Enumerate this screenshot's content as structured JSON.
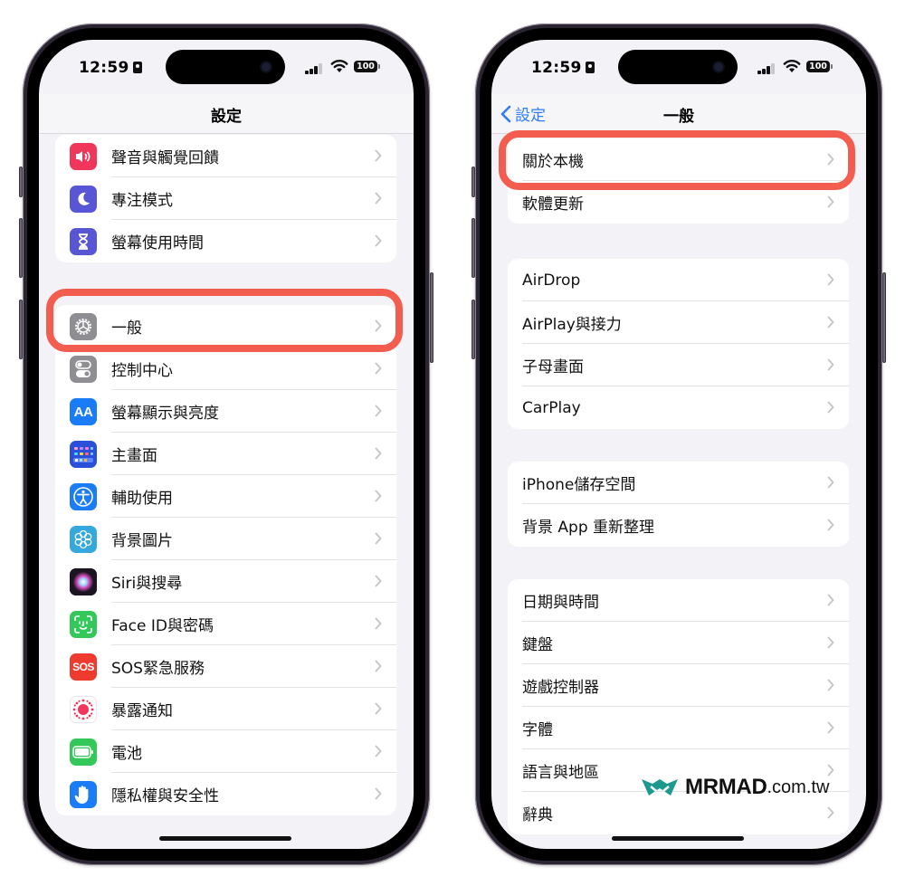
{
  "status_bar": {
    "time": "12:59",
    "battery": "100"
  },
  "left_screen": {
    "title": "設定",
    "groups": [
      {
        "items": [
          {
            "label": "聲音與觸覺回饋",
            "icon": "speaker-icon",
            "color": "#f0365a"
          },
          {
            "label": "專注模式",
            "icon": "moon-icon",
            "color": "#5956d6"
          },
          {
            "label": "螢幕使用時間",
            "icon": "hourglass-icon",
            "color": "#5956d6"
          }
        ]
      },
      {
        "items": [
          {
            "label": "一般",
            "icon": "gear-icon",
            "color": "#8e8e93",
            "highlighted": true
          },
          {
            "label": "控制中心",
            "icon": "toggle-icon",
            "color": "#8e8e93"
          },
          {
            "label": "螢幕顯示與亮度",
            "icon": "text-size-icon",
            "color": "#1a7cf6",
            "glyph": "AA"
          },
          {
            "label": "主畫面",
            "icon": "home-grid-icon",
            "color": "#2a4fd8"
          },
          {
            "label": "輔助使用",
            "icon": "accessibility-icon",
            "color": "#1a7cf6"
          },
          {
            "label": "背景圖片",
            "icon": "flower-icon",
            "color": "#35a9dc"
          },
          {
            "label": "Siri與搜尋",
            "icon": "siri-icon",
            "color": "#2a1a2e"
          },
          {
            "label": "Face ID與密碼",
            "icon": "face-id-icon",
            "color": "#34c759"
          },
          {
            "label": "SOS緊急服務",
            "icon": "sos-icon",
            "color": "#ee3b30",
            "glyph": "SOS"
          },
          {
            "label": "暴露通知",
            "icon": "exposure-icon",
            "color": "#ffffff"
          },
          {
            "label": "電池",
            "icon": "battery-icon",
            "color": "#34c759"
          },
          {
            "label": "隱私權與安全性",
            "icon": "hand-icon",
            "color": "#1a7cf6"
          }
        ]
      }
    ]
  },
  "right_screen": {
    "title": "一般",
    "back_label": "設定",
    "groups": [
      {
        "items": [
          {
            "label": "關於本機",
            "highlighted": true
          },
          {
            "label": "軟體更新"
          }
        ]
      },
      {
        "items": [
          {
            "label": "AirDrop"
          },
          {
            "label": "AirPlay與接力"
          },
          {
            "label": "子母畫面"
          },
          {
            "label": "CarPlay"
          }
        ]
      },
      {
        "items": [
          {
            "label": "iPhone儲存空間"
          },
          {
            "label": "背景 App 重新整理"
          }
        ]
      },
      {
        "items": [
          {
            "label": "日期與時間"
          },
          {
            "label": "鍵盤"
          },
          {
            "label": "遊戲控制器"
          },
          {
            "label": "字體"
          },
          {
            "label": "語言與地區"
          },
          {
            "label": "辭典"
          }
        ]
      }
    ]
  },
  "highlight_color": "#f25d50",
  "watermark": {
    "brand": "MRMAD",
    "domain": ".com.tw",
    "color": "#1c9a8e"
  }
}
